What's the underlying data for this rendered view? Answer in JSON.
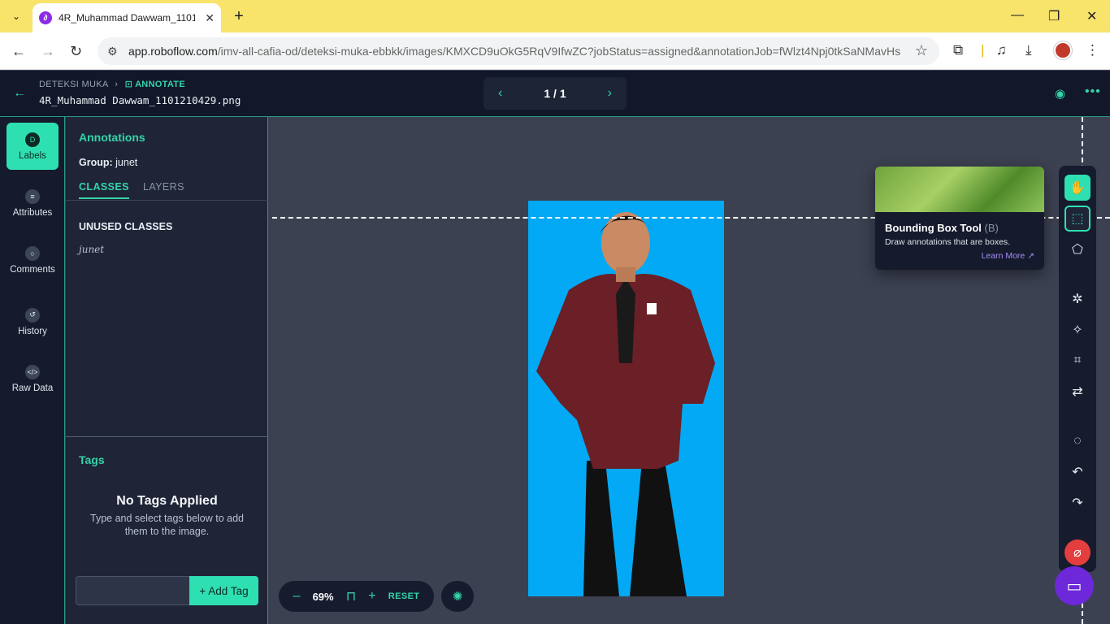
{
  "browser": {
    "tab_title": "4R_Muhammad Dawwam_1101",
    "url_host": "app.roboflow.com",
    "url_path": "/imv-all-cafia-od/deteksi-muka-ebbkk/images/KMXCD9uOkG5RqV9IfwZC?jobStatus=assigned&annotationJob=fWlzt4Npj0tkSaNMavHs"
  },
  "header": {
    "breadcrumb_parent": "DETEKSI MUKA",
    "breadcrumb_current": "ANNOTATE",
    "filename": "4R_Muhammad Dawwam_1101210429.png",
    "pager": "1 / 1"
  },
  "rail": [
    {
      "label": "Labels",
      "icon": "D"
    },
    {
      "label": "Attributes",
      "icon": "≡"
    },
    {
      "label": "Comments",
      "icon": "○"
    },
    {
      "label": "History",
      "icon": "↺"
    },
    {
      "label": "Raw Data",
      "icon": "</>"
    }
  ],
  "panel": {
    "title": "Annotations",
    "group_label": "Group:",
    "group_value": "junet",
    "tab_classes": "CLASSES",
    "tab_layers": "LAYERS",
    "unused_heading": "UNUSED CLASSES",
    "class_item": "junet",
    "tags_title": "Tags",
    "no_tags": "No Tags Applied",
    "no_tags_sub": "Type and select tags below to add them to the image.",
    "add_tag": "+ Add Tag"
  },
  "canvas": {
    "zoom": "69%",
    "reset": "RESET"
  },
  "tooltip": {
    "title": "Bounding Box Tool",
    "shortcut": "(B)",
    "description": "Draw annotations that are boxes.",
    "link": "Learn More ↗"
  },
  "colors": {
    "accent": "#34d4a9",
    "image_bg": "#03a9f4"
  }
}
